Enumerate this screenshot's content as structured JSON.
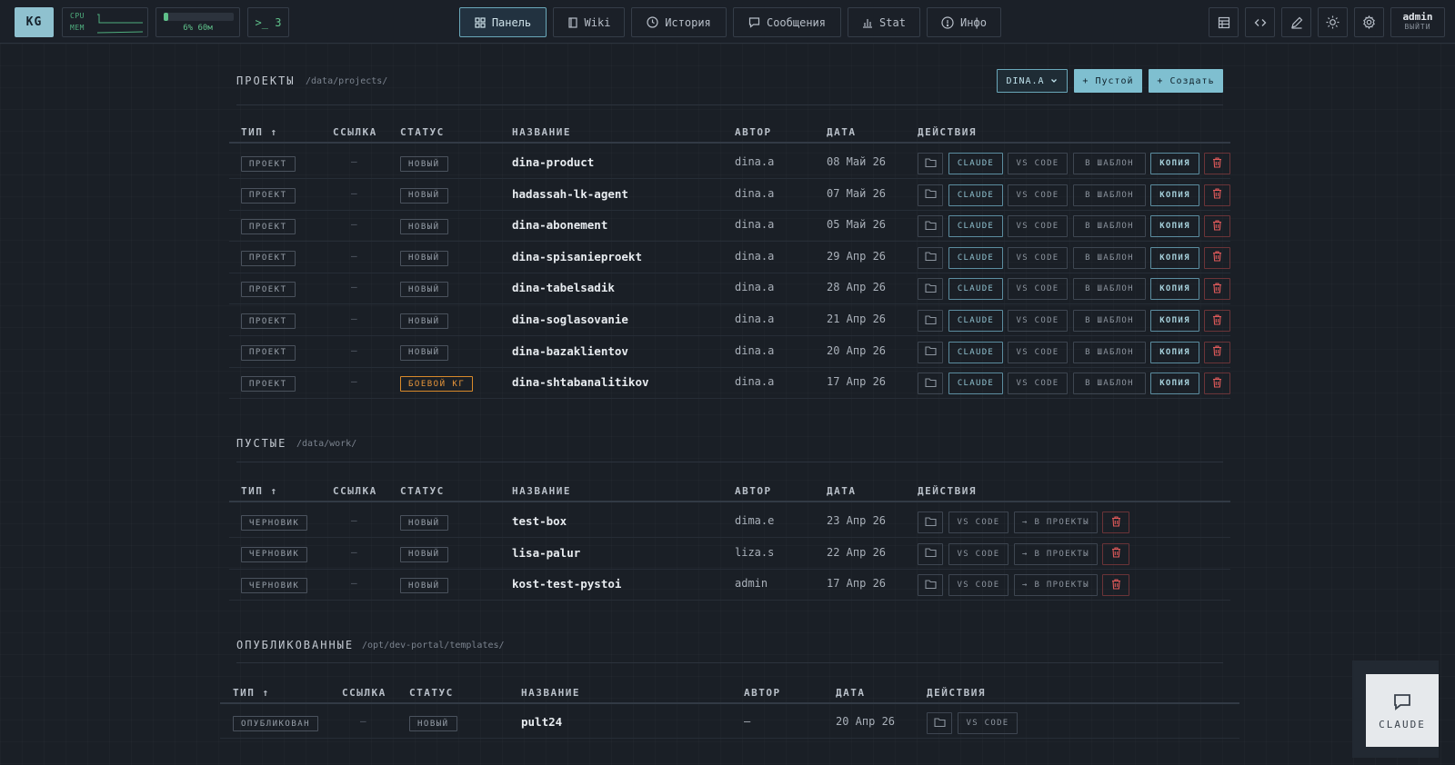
{
  "topbar": {
    "logo": "KG",
    "sys": {
      "cpu_label": "CPU",
      "mem_label": "MEM"
    },
    "disk": {
      "text": "6% 60м",
      "fill_percent": 6
    },
    "terminal": ">_ 3",
    "nav": [
      {
        "label": "Панель",
        "icon": "grid-icon",
        "active": true
      },
      {
        "label": "Wiki",
        "icon": "book-icon"
      },
      {
        "label": "История",
        "icon": "clock-icon"
      },
      {
        "label": "Сообщения",
        "icon": "message-icon"
      },
      {
        "label": "Stat",
        "icon": "bar-chart-icon"
      },
      {
        "label": "Инфо",
        "icon": "info-icon"
      }
    ],
    "tools": [
      "table-icon",
      "code-icon",
      "edit-icon",
      "sun-icon",
      "gear-icon"
    ],
    "user": {
      "name": "admin",
      "logout": "ВЫЙТИ"
    }
  },
  "columns": {
    "type": "ТИП ↑",
    "link": "ССЫЛКА",
    "status": "СТАТУС",
    "name": "НАЗВАНИЕ",
    "author": "АВТОР",
    "date": "ДАТА",
    "actions": "ДЕЙСТВИЯ"
  },
  "actions": {
    "claude": "CLAUDE",
    "vscode": "VS CODE",
    "template": "В ШАБЛОН",
    "copy": "КОПИЯ",
    "to_projects": "→ В ПРОЕКТЫ"
  },
  "projects": {
    "title": "ПРОЕКТЫ",
    "path": "/data/projects/",
    "filter": "DINA.A",
    "btn_empty": "+ Пустой",
    "btn_create": "+ Создать",
    "rows": [
      {
        "type": "ПРОЕКТ",
        "link": "—",
        "status": "НОВЫЙ",
        "name": "dina-product",
        "author": "dina.a",
        "date": "08 Май 26"
      },
      {
        "type": "ПРОЕКТ",
        "link": "—",
        "status": "НОВЫЙ",
        "name": "hadassah-lk-agent",
        "author": "dina.a",
        "date": "07 Май 26"
      },
      {
        "type": "ПРОЕКТ",
        "link": "—",
        "status": "НОВЫЙ",
        "name": "dina-abonement",
        "author": "dina.a",
        "date": "05 Май 26"
      },
      {
        "type": "ПРОЕКТ",
        "link": "—",
        "status": "НОВЫЙ",
        "name": "dina-spisanieproekt",
        "author": "dina.a",
        "date": "29 Апр 26"
      },
      {
        "type": "ПРОЕКТ",
        "link": "—",
        "status": "НОВЫЙ",
        "name": "dina-tabelsadik",
        "author": "dina.a",
        "date": "28 Апр 26"
      },
      {
        "type": "ПРОЕКТ",
        "link": "—",
        "status": "НОВЫЙ",
        "name": "dina-soglasovanie",
        "author": "dina.a",
        "date": "21 Апр 26"
      },
      {
        "type": "ПРОЕКТ",
        "link": "—",
        "status": "НОВЫЙ",
        "name": "dina-bazaklientov",
        "author": "dina.a",
        "date": "20 Апр 26"
      },
      {
        "type": "ПРОЕКТ",
        "link": "—",
        "status": "БОЕВОЙ КГ",
        "status_warn": true,
        "name": "dina-shtabanalitikov",
        "author": "dina.a",
        "date": "17 Апр 26"
      }
    ]
  },
  "empty": {
    "title": "ПУСТЫЕ",
    "path": "/data/work/",
    "rows": [
      {
        "type": "ЧЕРНОВИК",
        "link": "—",
        "status": "НОВЫЙ",
        "name": "test-box",
        "author": "dima.e",
        "date": "23 Апр 26"
      },
      {
        "type": "ЧЕРНОВИК",
        "link": "—",
        "status": "НОВЫЙ",
        "name": "lisa-palur",
        "author": "liza.s",
        "date": "22 Апр 26"
      },
      {
        "type": "ЧЕРНОВИК",
        "link": "—",
        "status": "НОВЫЙ",
        "name": "kost-test-pystoi",
        "author": "admin",
        "date": "17 Апр 26"
      }
    ]
  },
  "published": {
    "title": "ОПУБЛИКОВАННЫЕ",
    "path": "/opt/dev-portal/templates/",
    "rows": [
      {
        "type": "ОПУБЛИКОВАН",
        "link": "—",
        "status": "НОВЫЙ",
        "name": "pult24",
        "author": "—",
        "date": "20 Апр 26"
      }
    ]
  },
  "fab": {
    "label": "CLAUDE"
  },
  "colors": {
    "accent": "#7fbfd0",
    "danger": "#e05a5a",
    "warn": "#e7953a",
    "ok": "#5fc08a"
  }
}
